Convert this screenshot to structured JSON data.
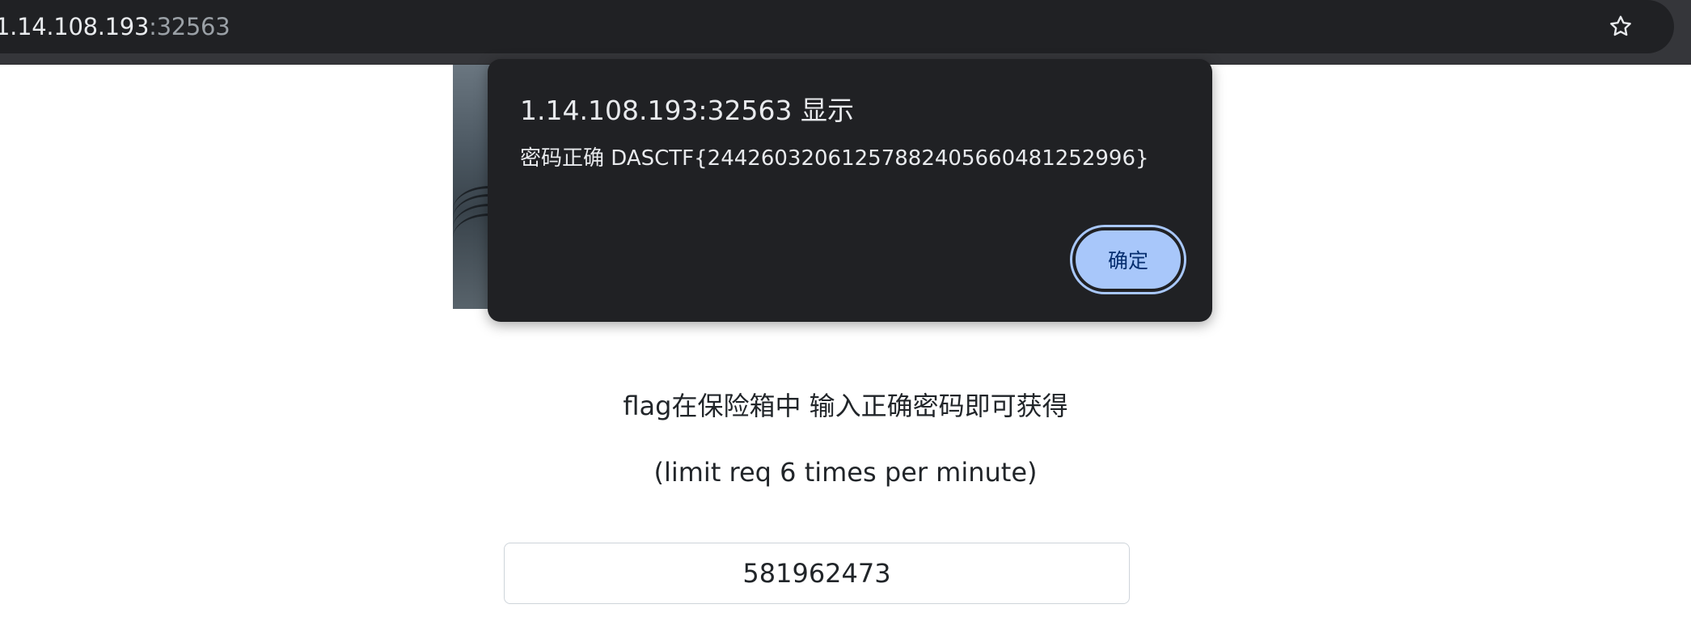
{
  "browser": {
    "url_host": "1.14.108.193",
    "url_port": ":32563",
    "bookmark_icon": "star-outline-icon"
  },
  "page": {
    "instruction": "flag在保险箱中 输入正确密码即可获得",
    "rate_limit": "(limit req 6 times per minute)",
    "password_value": "581962473"
  },
  "dialog": {
    "title": "1.14.108.193:32563 显示",
    "message": "密码正确 DASCTF{24426032061257882405660481252996}",
    "ok_label": "确定"
  },
  "colors": {
    "chrome_bg": "#35363a",
    "omnibox_bg": "#202124",
    "dialog_bg": "#202124",
    "ok_button_bg": "#a8c7fa",
    "ok_button_text": "#062e6f"
  }
}
